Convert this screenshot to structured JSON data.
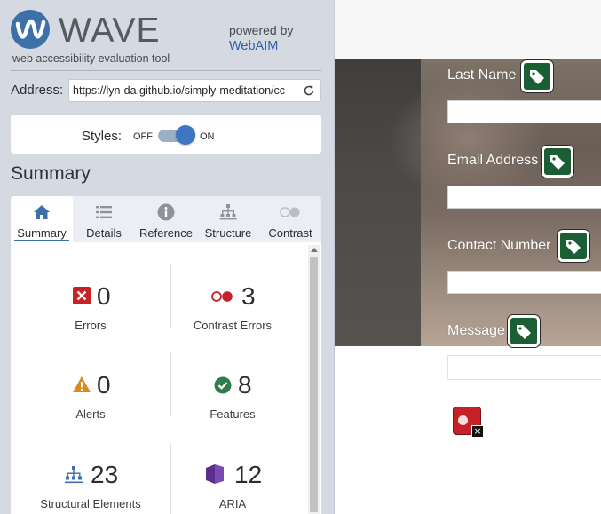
{
  "wave": {
    "logo_text": "WAVE",
    "tagline": "web accessibility evaluation tool",
    "powered_by": "powered by",
    "webaim_link": "WebAIM"
  },
  "address": {
    "label": "Address:",
    "value": "https://lyn-da.github.io/simply-meditation/cc"
  },
  "styles_toggle": {
    "label": "Styles:",
    "off_label": "OFF",
    "on_label": "ON",
    "state": "on"
  },
  "summary_heading": "Summary",
  "tabs": [
    {
      "label": "Summary",
      "icon": "home-icon",
      "active": true
    },
    {
      "label": "Details",
      "icon": "list-icon",
      "active": false
    },
    {
      "label": "Reference",
      "icon": "info-icon",
      "active": false
    },
    {
      "label": "Structure",
      "icon": "hierarchy-icon",
      "active": false
    },
    {
      "label": "Contrast",
      "icon": "contrast-icon",
      "active": false
    }
  ],
  "stats": {
    "errors": {
      "count": "0",
      "label": "Errors",
      "icon": "error-x-icon",
      "color": "#c62028"
    },
    "contrast_errors": {
      "count": "3",
      "label": "Contrast Errors",
      "icon": "contrast-dots-icon",
      "color": "#c62028"
    },
    "alerts": {
      "count": "0",
      "label": "Alerts",
      "icon": "warning-triangle-icon",
      "color": "#d98a1c"
    },
    "features": {
      "count": "8",
      "label": "Features",
      "icon": "check-circle-icon",
      "color": "#2f7d4a"
    },
    "structural": {
      "count": "23",
      "label": "Structural Elements",
      "icon": "structure-icon",
      "color": "#3d6fa8"
    },
    "aria": {
      "count": "12",
      "label": "ARIA",
      "icon": "aria-cube-icon",
      "color": "#5b2d8e"
    }
  },
  "page_preview": {
    "fields": [
      {
        "label": "Last Name",
        "icon": "tag-icon"
      },
      {
        "label": "Email Address",
        "icon": "tag-icon"
      },
      {
        "label": "Contact Number",
        "icon": "tag-icon"
      },
      {
        "label": "Message",
        "icon": "tag-icon"
      }
    ],
    "contrast_error_icon": "contrast-error-icon"
  },
  "colors": {
    "sidebar_bg": "#d5d9e2",
    "brand_blue": "#3d6fa8",
    "feature_green": "#1b5e34",
    "error_red": "#c62028"
  }
}
